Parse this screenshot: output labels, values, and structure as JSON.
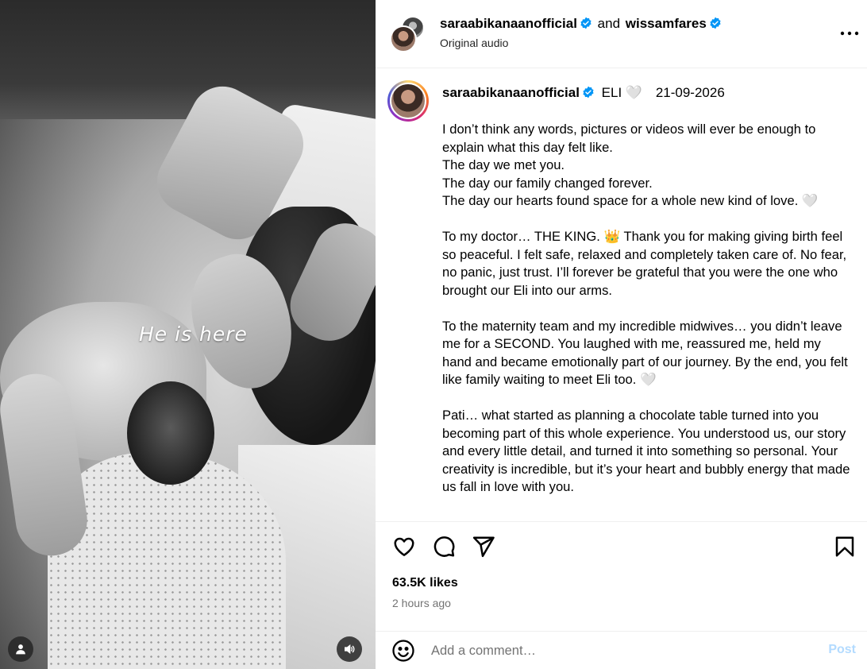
{
  "media": {
    "overlay_text": "He is here"
  },
  "header": {
    "user1": "saraabikanaanofficial",
    "and": "and",
    "user2": "wissamfares",
    "subtitle": "Original audio"
  },
  "caption": {
    "username": "saraabikanaanofficial",
    "title": "ELI",
    "heart": "🤍",
    "date": "21-09-2026",
    "paragraphs": [
      "I don’t think any words, pictures or videos will ever be enough to explain what this day felt like.\nThe day we met you.\nThe day our family changed forever.\nThe day our hearts found space for a whole new kind of love. 🤍",
      "To my doctor… THE KING. 👑 Thank you for making giving birth feel so peaceful. I felt safe, relaxed and completely taken care of. No fear, no panic, just trust. I’ll forever be grateful that you were the one who brought our Eli into our arms.",
      "To the maternity team and my incredible midwives… you didn’t leave me for a SECOND. You laughed with me, reassured me, held my hand and became emotionally part of our journey. By the end, you felt like family waiting to meet Eli too. 🤍",
      "Pati… what started as planning a chocolate table turned into you becoming part of this whole experience. You understood us, our story and every little detail, and turned it into something so personal. Your creativity is incredible, but it’s your heart and bubbly energy that made us fall in love with you."
    ]
  },
  "stats": {
    "likes": "63.5K likes",
    "time_ago": "2 hours ago"
  },
  "comment": {
    "placeholder": "Add a comment…",
    "post_label": "Post"
  },
  "icons": {
    "verified_color": "#0095f6",
    "post_color": "#b3dbff"
  }
}
